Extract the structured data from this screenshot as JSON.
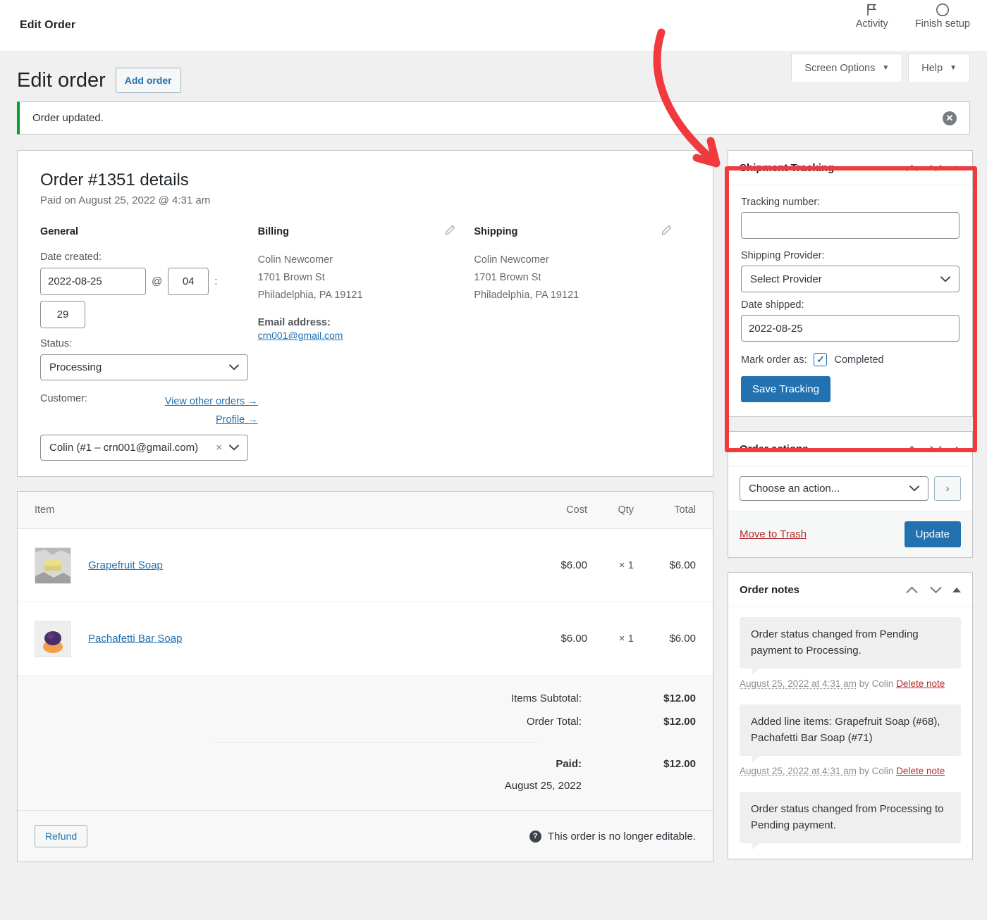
{
  "adminbar": {
    "title": "Edit Order",
    "items": [
      {
        "icon": "flag-icon",
        "label": "Activity"
      },
      {
        "icon": "circle-icon",
        "label": "Finish setup"
      }
    ]
  },
  "screen_meta": {
    "screen_options": "Screen Options",
    "help": "Help",
    "caret": "▼"
  },
  "page": {
    "title": "Edit order",
    "add_order": "Add order"
  },
  "notice": {
    "text": "Order updated.",
    "dismiss": "✕",
    "accent_color": "#00a32a"
  },
  "order": {
    "heading": "Order #1351 details",
    "subheading": "Paid on August 25, 2022 @ 4:31 am",
    "general": {
      "heading": "General",
      "date_label": "Date created:",
      "date_value": "2022-08-25",
      "at_symbol": "@",
      "hour_value": "04",
      "colon": ":",
      "minute_value": "29",
      "status_label": "Status:",
      "status_value": "Processing",
      "customer_label": "Customer:",
      "view_other_orders": "View other orders →",
      "profile": "Profile →",
      "customer_value": "Colin (#1 – crn001@gmail.com)",
      "customer_clear": "×"
    },
    "billing": {
      "heading": "Billing",
      "name": "Colin Newcomer",
      "street": "1701 Brown St",
      "city": "Philadelphia, PA 19121",
      "email_label": "Email address:",
      "email": "crn001@gmail.com"
    },
    "shipping": {
      "heading": "Shipping",
      "name": "Colin Newcomer",
      "street": "1701 Brown St",
      "city": "Philadelphia, PA 19121"
    }
  },
  "items": {
    "columns": {
      "item": "Item",
      "cost": "Cost",
      "qty": "Qty",
      "total": "Total"
    },
    "rows": [
      {
        "name": "Grapefruit Soap",
        "cost": "$6.00",
        "qty": "× 1",
        "total": "$6.00"
      },
      {
        "name": "Pachafetti Bar Soap",
        "cost": "$6.00",
        "qty": "× 1",
        "total": "$6.00"
      }
    ],
    "totals": [
      {
        "label": "Items Subtotal:",
        "value": "$12.00"
      },
      {
        "label": "Order Total:",
        "value": "$12.00"
      }
    ],
    "paid_label": "Paid:",
    "paid_value": "$12.00",
    "paid_date": "August 25, 2022",
    "refund_button": "Refund",
    "not_editable": "This order is no longer editable."
  },
  "shipment_tracking": {
    "title": "Shipment Tracking",
    "tracking_label": "Tracking number:",
    "tracking_value": "",
    "tracking_placeholder": "",
    "provider_label": "Shipping Provider:",
    "provider_value": "Select Provider",
    "date_label": "Date shipped:",
    "date_value": "2022-08-25",
    "mark_label": "Mark order as:",
    "mark_checked": "✓",
    "mark_value": "Completed",
    "save_button": "Save Tracking",
    "highlight_color": "#f03a3e"
  },
  "order_actions": {
    "title": "Order actions",
    "choose_action": "Choose an action...",
    "go": "›",
    "move_to_trash": "Move to Trash",
    "update": "Update"
  },
  "order_notes": {
    "title": "Order notes",
    "notes": [
      {
        "text": "Order status changed from Pending payment to Processing.",
        "date": "August 25, 2022 at 4:31 am",
        "by": "by Colin",
        "delete": "Delete note"
      },
      {
        "text": "Added line items: Grapefruit Soap (#68), Pachafetti Bar Soap (#71)",
        "date": "August 25, 2022 at 4:31 am",
        "by": "by Colin",
        "delete": "Delete note"
      },
      {
        "text": "Order status changed from Processing to Pending payment.",
        "date": "",
        "by": "",
        "delete": ""
      }
    ]
  }
}
